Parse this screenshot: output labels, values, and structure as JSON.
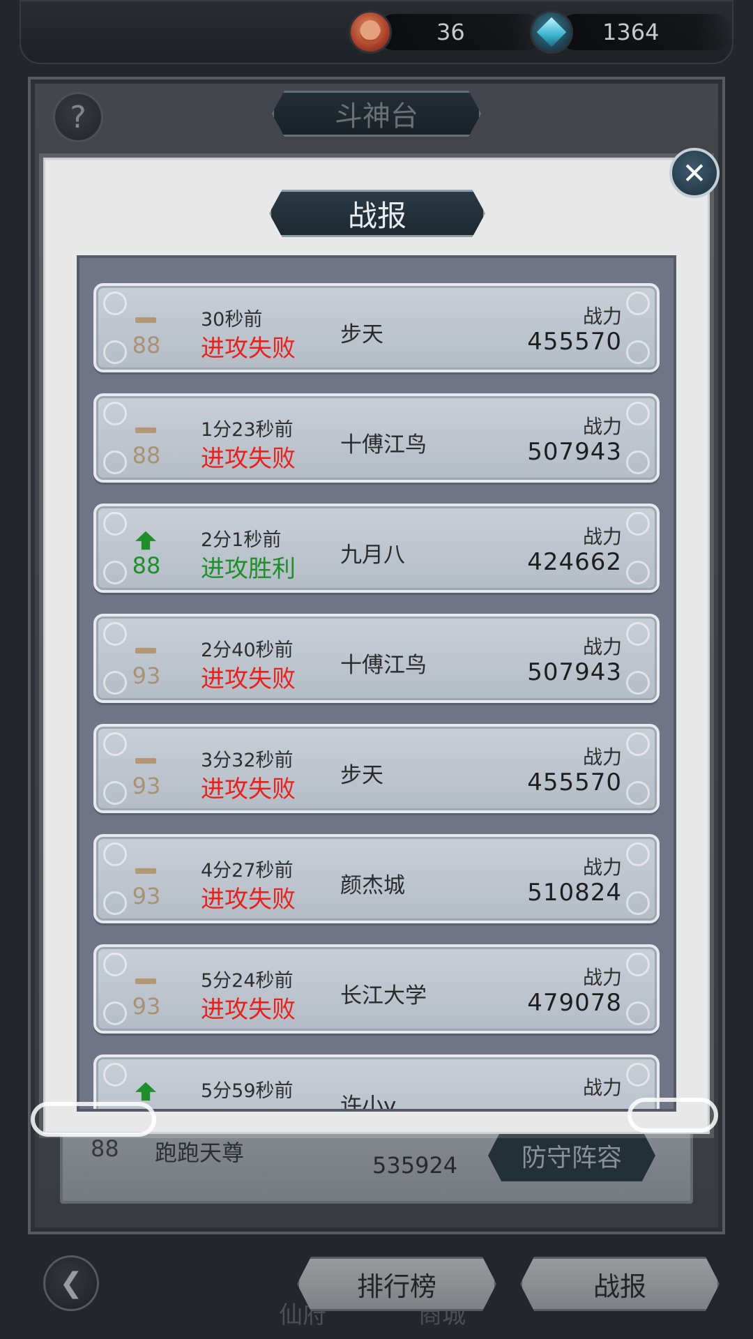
{
  "resources": [
    {
      "icon": "copper-coin-icon",
      "value": "36"
    },
    {
      "icon": "crystal-icon",
      "value": "1364"
    }
  ],
  "screen": {
    "title": "斗神台",
    "help_label": "?"
  },
  "underlying": {
    "rank": "88",
    "name": "跑跑天尊",
    "power": "535924",
    "defense_button": "防守阵容",
    "tabs": [
      "仙府",
      "商城"
    ]
  },
  "bottom_nav": {
    "rank_tab": "排行榜",
    "report_tab": "战报"
  },
  "modal": {
    "title": "战报",
    "close_label": "✕",
    "power_label": "战力",
    "reports": [
      {
        "trend": "flat",
        "rank": "88",
        "time": "30秒前",
        "result": "进攻失败",
        "win": false,
        "opponent": "步天",
        "power": "455570"
      },
      {
        "trend": "flat",
        "rank": "88",
        "time": "1分23秒前",
        "result": "进攻失败",
        "win": false,
        "opponent": "十傅江鸟",
        "power": "507943"
      },
      {
        "trend": "up",
        "rank": "88",
        "time": "2分1秒前",
        "result": "进攻胜利",
        "win": true,
        "opponent": "九月八",
        "power": "424662"
      },
      {
        "trend": "flat",
        "rank": "93",
        "time": "2分40秒前",
        "result": "进攻失败",
        "win": false,
        "opponent": "十傅江鸟",
        "power": "507943"
      },
      {
        "trend": "flat",
        "rank": "93",
        "time": "3分32秒前",
        "result": "进攻失败",
        "win": false,
        "opponent": "步天",
        "power": "455570"
      },
      {
        "trend": "flat",
        "rank": "93",
        "time": "4分27秒前",
        "result": "进攻失败",
        "win": false,
        "opponent": "颜杰城",
        "power": "510824"
      },
      {
        "trend": "flat",
        "rank": "93",
        "time": "5分24秒前",
        "result": "进攻失败",
        "win": false,
        "opponent": "长江大学",
        "power": "479078"
      },
      {
        "trend": "up",
        "rank": "",
        "time": "5分59秒前",
        "result": "",
        "win": true,
        "opponent": "许小y",
        "power": ""
      }
    ]
  }
}
